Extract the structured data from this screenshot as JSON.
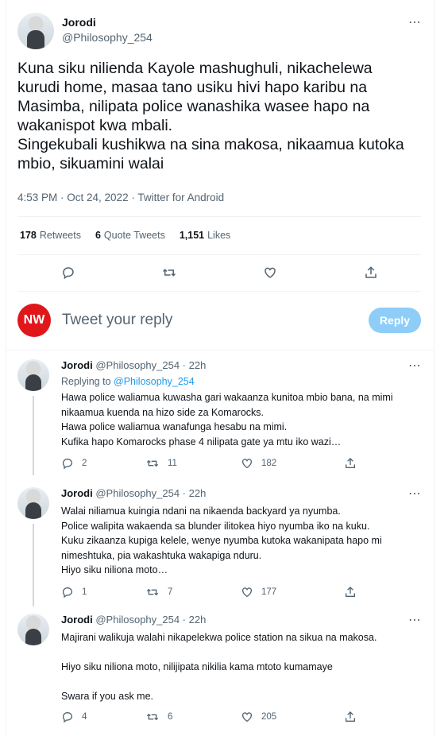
{
  "main_tweet": {
    "author_name": "Jorodi",
    "author_handle": "@Philosophy_254",
    "text": "Kuna siku nilienda Kayole mashughuli, nikachelewa kurudi home, masaa tano usiku hivi hapo karibu na Masimba, nilipata police wanashika wasee hapo na wakanispot kwa mbali.\nSingekubali kushikwa na sina makosa, nikaamua kutoka mbio, sikuamini walai",
    "meta": "4:53 PM · Oct 24, 2022 · Twitter for Android",
    "stats": {
      "retweets_count": "178",
      "retweets_label": "Retweets",
      "quotes_count": "6",
      "quotes_label": "Quote Tweets",
      "likes_count": "1,151",
      "likes_label": "Likes"
    },
    "more_icon": "⋯"
  },
  "reply_box": {
    "logo_text": "NW",
    "placeholder": "Tweet your reply",
    "button_label": "Reply"
  },
  "replies": [
    {
      "name": "Jorodi",
      "handle_time": "@Philosophy_254 · 22h",
      "replying_prefix": "Replying to",
      "replying_to": "@Philosophy_254",
      "text": "Hawa police waliamua kuwasha gari wakaanza kunitoa mbio bana, na mimi nikaamua kuenda na hizo side za Komarocks.\nHawa police waliamua wanafunga hesabu na mimi.\nKufika hapo Komarocks phase 4 nilipata gate ya mtu iko wazi…",
      "replies": "2",
      "retweets": "11",
      "likes": "182"
    },
    {
      "name": "Jorodi",
      "handle_time": "@Philosophy_254 · 22h",
      "text": "Walai niliamua kuingia ndani na nikaenda backyard ya nyumba.\nPolice walipita wakaenda sa blunder ilitokea hiyo nyumba iko na kuku.\nKuku zikaanza kupiga kelele, wenye nyumba kutoka wakanipata hapo mi nimeshtuka, pia wakashtuka wakapiga nduru.\nHiyo siku niliona moto…",
      "replies": "1",
      "retweets": "7",
      "likes": "177"
    },
    {
      "name": "Jorodi",
      "handle_time": "@Philosophy_254 · 22h",
      "text": "Majirani walikuja walahi nikapelekwa police station na sikua na makosa.\n\nHiyo siku niliona moto, nilijipata nikilia kama mtoto kumamaye\n\nSwara if you ask me.",
      "replies": "4",
      "retweets": "6",
      "likes": "205"
    }
  ],
  "colors": {
    "accent": "#1d9bf0",
    "reply_button": "#8ecdf8",
    "logo_red": "#e0161b",
    "muted": "#536471"
  },
  "icons": [
    "reply-icon",
    "retweet-icon",
    "like-icon",
    "share-icon",
    "more-icon"
  ]
}
